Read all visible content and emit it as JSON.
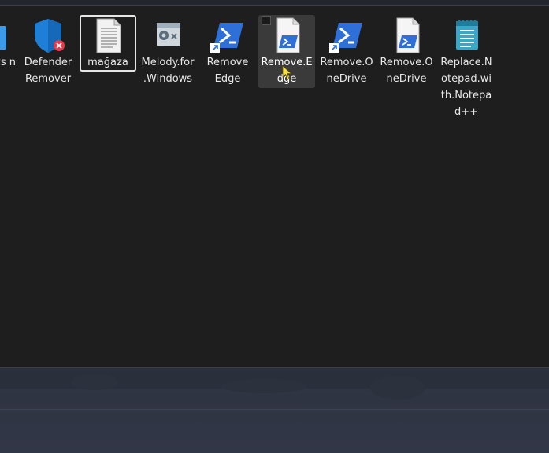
{
  "desktop": {
    "icons": [
      {
        "id": "partial",
        "label": "y_ ws n"
      },
      {
        "id": "defender",
        "label": "DefenderRemover"
      },
      {
        "id": "magaza",
        "label": "mağaza"
      },
      {
        "id": "melody",
        "label": "Melody.for.Windows"
      },
      {
        "id": "remove-edge-shortcut",
        "label": "Remove Edge"
      },
      {
        "id": "remove-edge-script",
        "label": "Remove.Edge"
      },
      {
        "id": "remove-onedrive-shortcut",
        "label": "Remove.OneDrive"
      },
      {
        "id": "remove-onedrive-script",
        "label": "Remove.OneDrive"
      },
      {
        "id": "replace-notepad",
        "label": "Replace.Notepad.with.Notepad++"
      }
    ],
    "focused_item": "mağaza",
    "hovered_item": "Remove.Edge"
  },
  "colors": {
    "folder_bg": "#1e1e1e",
    "powershell_blue": "#2f6fd8",
    "notepad_teal": "#3aa6c8",
    "defender_blue": "#1e7fd8",
    "error_red": "#e23b4a"
  }
}
